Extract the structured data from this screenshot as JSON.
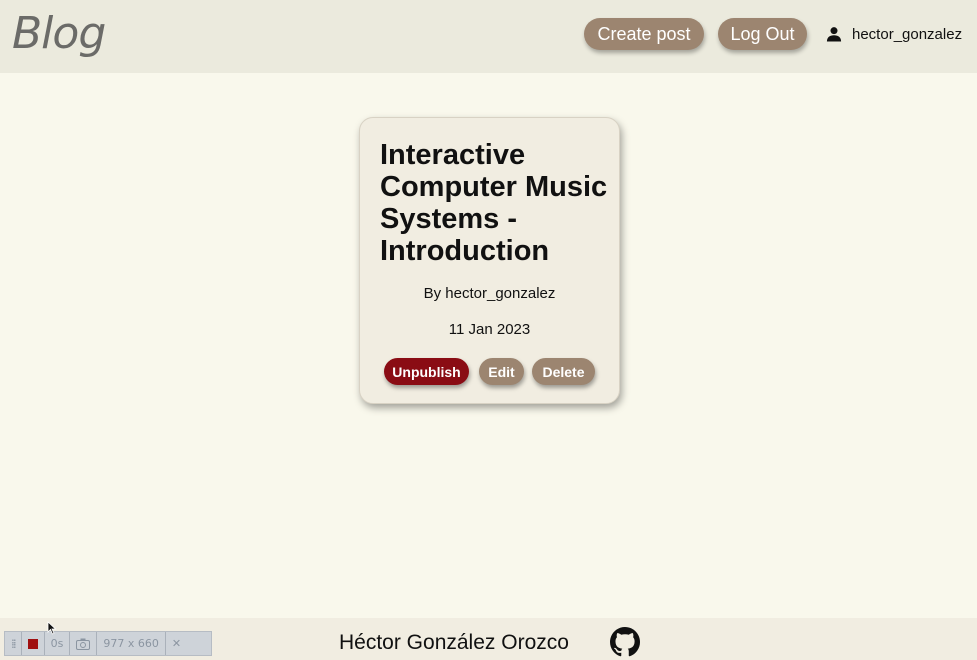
{
  "header": {
    "logo": "Blog",
    "create_post_label": "Create post",
    "logout_label": "Log Out",
    "username": "hector_gonzalez",
    "user_icon": "person-icon"
  },
  "post": {
    "title": "Interactive Computer Music Systems - Introduction",
    "author": "By hector_gonzalez",
    "date": "11 Jan 2023",
    "unpublish_label": "Unpublish",
    "edit_label": "Edit",
    "delete_label": "Delete"
  },
  "footer": {
    "name": "Héctor González Orozco",
    "github_icon": "github-icon"
  },
  "toolbar": {
    "timer": "0s",
    "dimensions": "977 x 660",
    "close": "✕"
  },
  "colors": {
    "background": "#f9f8ec",
    "header": "#ebeadd",
    "accent": "#9c8570",
    "danger": "#8a0c14"
  }
}
